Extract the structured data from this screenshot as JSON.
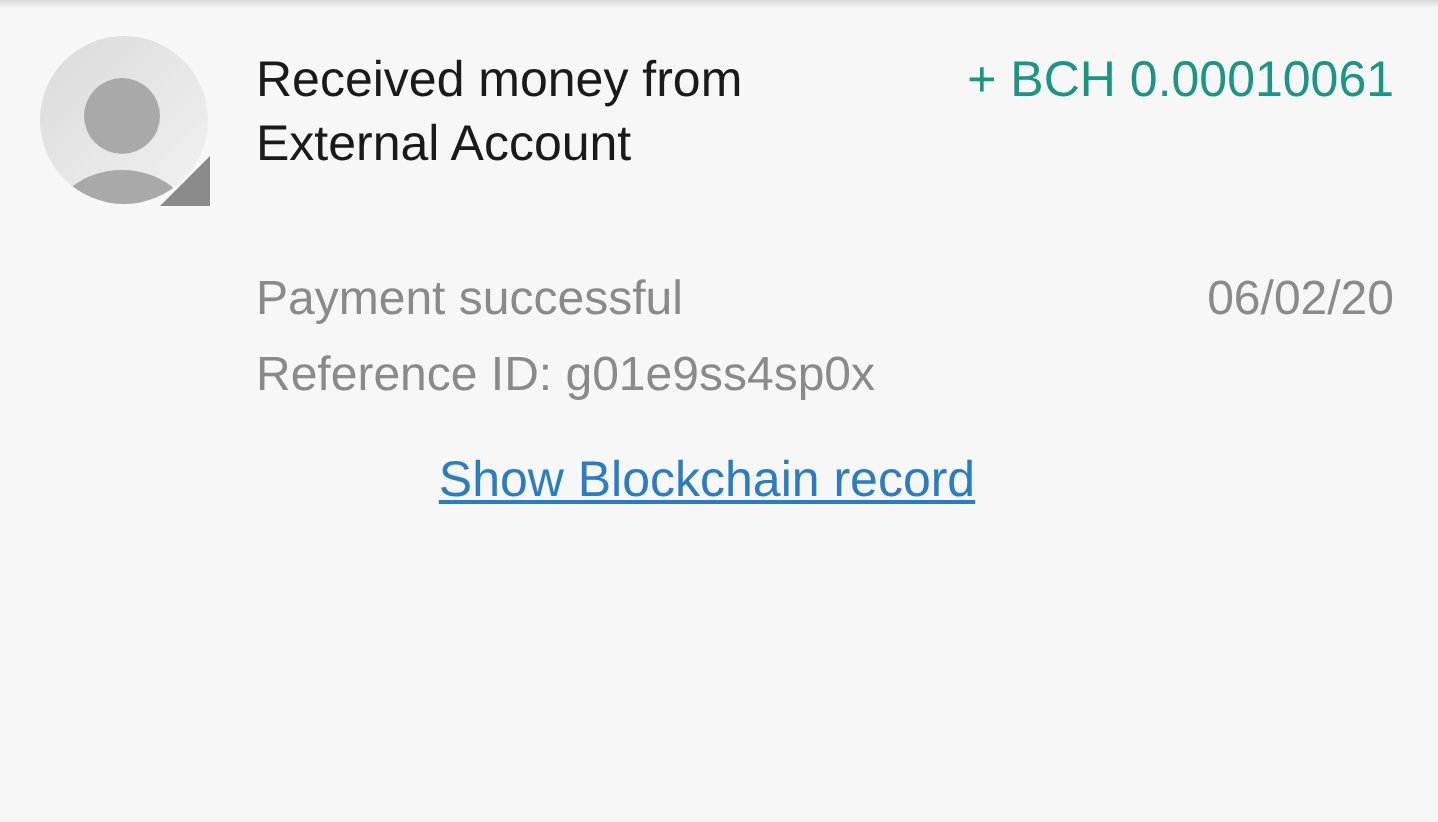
{
  "transaction": {
    "title": "Received money from External Account",
    "amount": "+ BCH 0.00010061",
    "status": "Payment successful",
    "date": "06/02/20",
    "reference": "Reference ID: g01e9ss4sp0x",
    "link": "Show Blockchain record"
  }
}
